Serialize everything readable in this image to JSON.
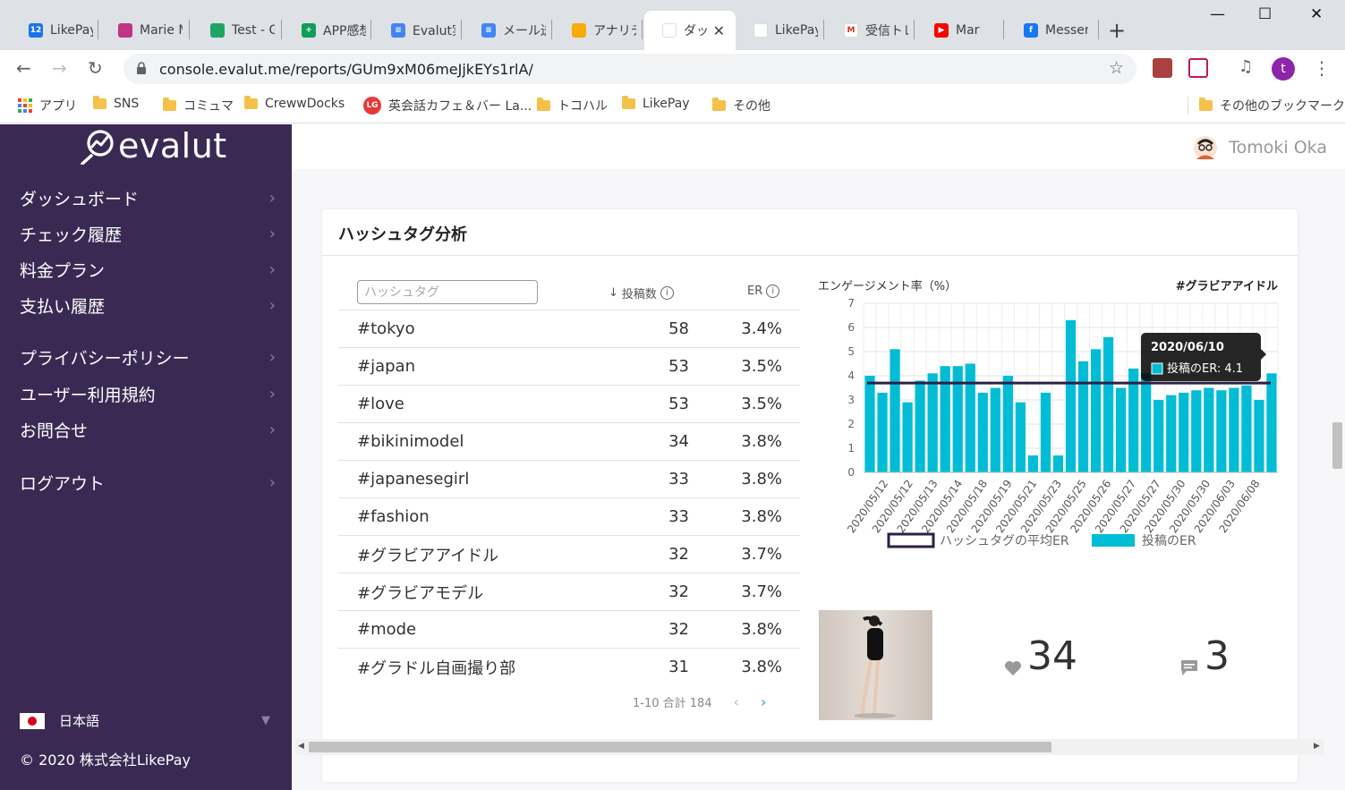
{
  "browser": {
    "tabs": [
      {
        "title": "LikePay",
        "favicon": "calendar-icon",
        "color": "#1a73e8",
        "glyph": "12"
      },
      {
        "title": "Marie M",
        "favicon": "instagram-icon",
        "color": "#c13584",
        "glyph": ""
      },
      {
        "title": "Test - G",
        "favicon": "drive-icon",
        "color": "#1fa463",
        "glyph": ""
      },
      {
        "title": "APP感想",
        "favicon": "sheets-icon",
        "color": "#0f9d58",
        "glyph": "+"
      },
      {
        "title": "Evalut実",
        "favicon": "docs-icon",
        "color": "#4285f4",
        "glyph": "≡"
      },
      {
        "title": "メール送",
        "favicon": "docs-icon",
        "color": "#4285f4",
        "glyph": "≡"
      },
      {
        "title": "アナリティ",
        "favicon": "analytics-icon",
        "color": "#f9ab00",
        "glyph": ""
      },
      {
        "title": "ダッ",
        "favicon": "evalut-icon",
        "color": "#ffffff",
        "glyph": "",
        "active": true
      },
      {
        "title": "LikePay",
        "favicon": "likepay-icon",
        "color": "#ffffff",
        "glyph": ""
      },
      {
        "title": "受信トレ",
        "favicon": "gmail-icon",
        "color": "#ffffff",
        "glyph": "M"
      },
      {
        "title": "Mar",
        "favicon": "youtube-icon",
        "color": "#ff0000",
        "glyph": "▶"
      },
      {
        "title": "Messen",
        "favicon": "facebook-icon",
        "color": "#1877f2",
        "glyph": "f"
      }
    ],
    "url": "console.evalut.me/reports/GUm9xM06meJjkEYs1rlA/",
    "bookmarks": [
      {
        "label": "アプリ",
        "icon": "apps-grid-icon"
      },
      {
        "label": "SNS",
        "icon": "folder-icon"
      },
      {
        "label": "コミュマ",
        "icon": "folder-icon"
      },
      {
        "label": "CrewwDocks",
        "icon": "folder-icon"
      },
      {
        "label": "英会話カフェ＆バー La...",
        "icon": "lingo-icon"
      },
      {
        "label": "トコハル",
        "icon": "folder-icon"
      },
      {
        "label": "LikePay",
        "icon": "folder-icon"
      },
      {
        "label": "その他",
        "icon": "folder-icon"
      }
    ],
    "other_bookmarks": "その他のブックマーク",
    "profile_initial": "t"
  },
  "sidebar": {
    "logo": "evalut",
    "nav": [
      {
        "label": "ダッシュボード"
      },
      {
        "label": "チェック履歴"
      },
      {
        "label": "料金プラン"
      },
      {
        "label": "支払い履歴"
      },
      {
        "label": "プライバシーポリシー"
      },
      {
        "label": "ユーザー利用規約"
      },
      {
        "label": "お問合せ"
      },
      {
        "label": "ログアウト"
      }
    ],
    "language": "日本語",
    "copyright": "© 2020 株式会社LikePay"
  },
  "header": {
    "user_name": "Tomoki Oka"
  },
  "card": {
    "title": "ハッシュタグ分析",
    "search_placeholder": "ハッシュタグ",
    "col_posts": "投稿数",
    "col_er": "ER",
    "rows": [
      {
        "tag": "#tokyo",
        "posts": "58",
        "er": "3.4%"
      },
      {
        "tag": "#japan",
        "posts": "53",
        "er": "3.5%"
      },
      {
        "tag": "#love",
        "posts": "53",
        "er": "3.5%"
      },
      {
        "tag": "#bikinimodel",
        "posts": "34",
        "er": "3.8%"
      },
      {
        "tag": "#japanesegirl",
        "posts": "33",
        "er": "3.8%"
      },
      {
        "tag": "#fashion",
        "posts": "33",
        "er": "3.8%"
      },
      {
        "tag": "#グラビアアイドル",
        "posts": "32",
        "er": "3.7%"
      },
      {
        "tag": "#グラビアモデル",
        "posts": "32",
        "er": "3.7%"
      },
      {
        "tag": "#mode",
        "posts": "32",
        "er": "3.8%"
      },
      {
        "tag": "#グラドル自画撮り部",
        "posts": "31",
        "er": "3.8%"
      }
    ],
    "pagination": "1-10 合計 184",
    "likes": "34",
    "comments": "3"
  },
  "chart_data": {
    "type": "bar",
    "title": "エンゲージメント率（%）",
    "subtitle": "#グラビアアイドル",
    "ylim": [
      0,
      7
    ],
    "yticks": [
      0,
      1,
      2,
      3,
      4,
      5,
      6,
      7
    ],
    "xtick_labels": [
      "2020/05/12",
      "2020/05/12",
      "2020/05/13",
      "2020/05/14",
      "2020/05/18",
      "2020/05/19",
      "2020/05/21",
      "2020/05/23",
      "2020/05/25",
      "2020/05/26",
      "2020/05/27",
      "2020/05/27",
      "2020/05/30",
      "2020/05/30",
      "2020/06/03",
      "2020/06/08"
    ],
    "values": [
      4.0,
      3.3,
      5.1,
      2.9,
      3.8,
      4.1,
      4.4,
      4.4,
      4.5,
      3.3,
      3.5,
      4.0,
      2.9,
      0.7,
      3.3,
      0.7,
      6.3,
      4.6,
      5.1,
      5.6,
      3.5,
      4.3,
      4.1,
      3.0,
      3.2,
      3.3,
      3.4,
      3.5,
      3.4,
      3.5,
      3.6,
      3.0,
      4.1
    ],
    "average": 3.7,
    "grid": true,
    "legend_position": "bottom",
    "series": [
      {
        "name": "ハッシュタグの平均ER",
        "color": "#2e1f45"
      },
      {
        "name": "投稿のER",
        "color": "#00bcd4"
      }
    ],
    "tooltip": {
      "date": "2020/06/10",
      "label": "投稿のER: 4.1"
    }
  }
}
